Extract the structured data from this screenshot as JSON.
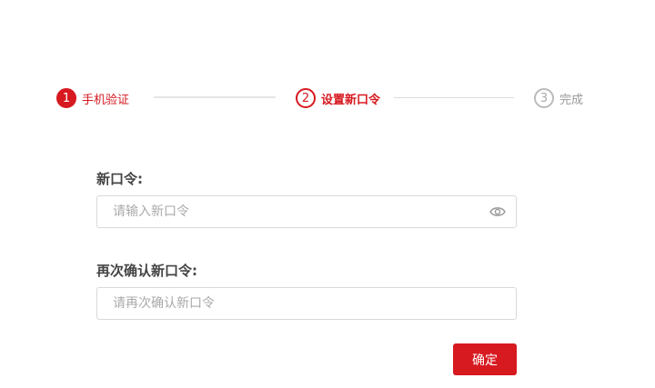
{
  "stepper": {
    "steps": [
      {
        "number": "1",
        "label": "手机验证",
        "state": "completed"
      },
      {
        "number": "2",
        "label": "设置新口令",
        "state": "active"
      },
      {
        "number": "3",
        "label": "完成",
        "state": "pending"
      }
    ]
  },
  "form": {
    "new_password": {
      "label": "新口令:",
      "placeholder": "请输入新口令",
      "value": "",
      "toggle_icon": "eye-icon"
    },
    "confirm_password": {
      "label": "再次确认新口令:",
      "placeholder": "请再次确认新口令",
      "value": ""
    },
    "submit_label": "确定"
  },
  "colors": {
    "accent": "#d71920",
    "pending": "#999999",
    "border": "#d9d9d9",
    "placeholder": "#aaaaaa"
  }
}
